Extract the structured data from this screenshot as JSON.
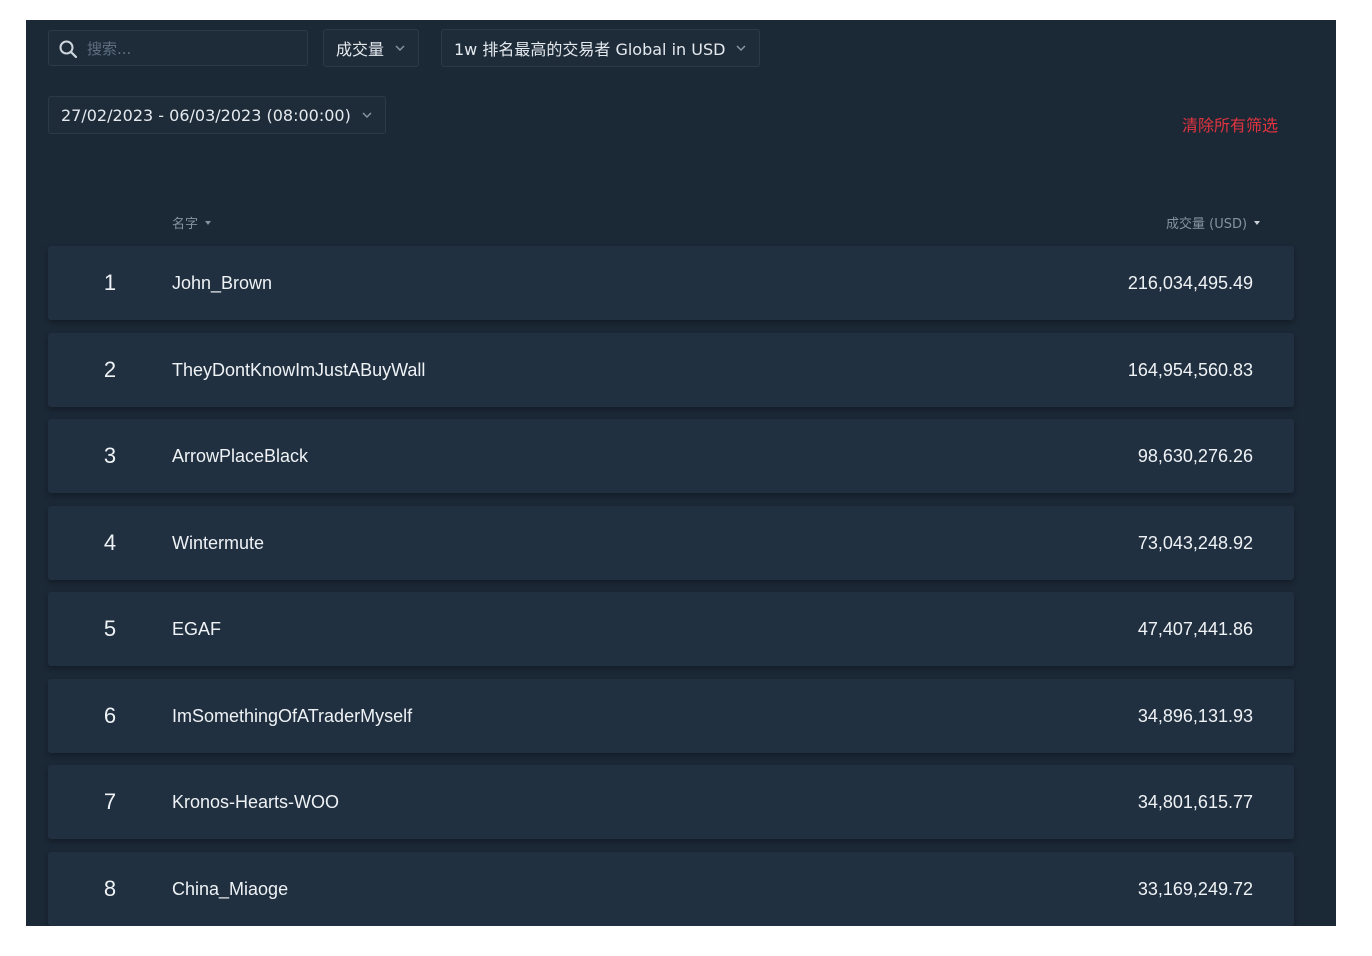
{
  "filters": {
    "search_placeholder": "搜索...",
    "metric_label": "成交量",
    "ranking_label": "1w 排名最高的交易者 Global in USD",
    "date_range": "27/02/2023 - 06/03/2023 (08:00:00)",
    "clear_all": "清除所有筛选"
  },
  "table": {
    "columns": {
      "name": "名字",
      "volume": "成交量 (USD)"
    },
    "rows": [
      {
        "rank": "1",
        "name": "John_Brown",
        "volume": "216,034,495.49"
      },
      {
        "rank": "2",
        "name": "TheyDontKnowImJustABuyWall",
        "volume": "164,954,560.83"
      },
      {
        "rank": "3",
        "name": "ArrowPlaceBlack",
        "volume": "98,630,276.26"
      },
      {
        "rank": "4",
        "name": "Wintermute",
        "volume": "73,043,248.92"
      },
      {
        "rank": "5",
        "name": "EGAF",
        "volume": "47,407,441.86"
      },
      {
        "rank": "6",
        "name": "ImSomethingOfATraderMyself",
        "volume": "34,896,131.93"
      },
      {
        "rank": "7",
        "name": "Kronos-Hearts-WOO",
        "volume": "34,801,615.77"
      },
      {
        "rank": "8",
        "name": "China_Miaoge",
        "volume": "33,169,249.72"
      }
    ]
  },
  "icons": {
    "search": "search-icon",
    "dropdown": "chevron-down-icon",
    "sort": "sort-down-icon"
  },
  "colors": {
    "background": "#1b2836",
    "row": "#213040",
    "text": "#eef2f5",
    "muted": "#8593a1",
    "danger": "#e0343f"
  }
}
